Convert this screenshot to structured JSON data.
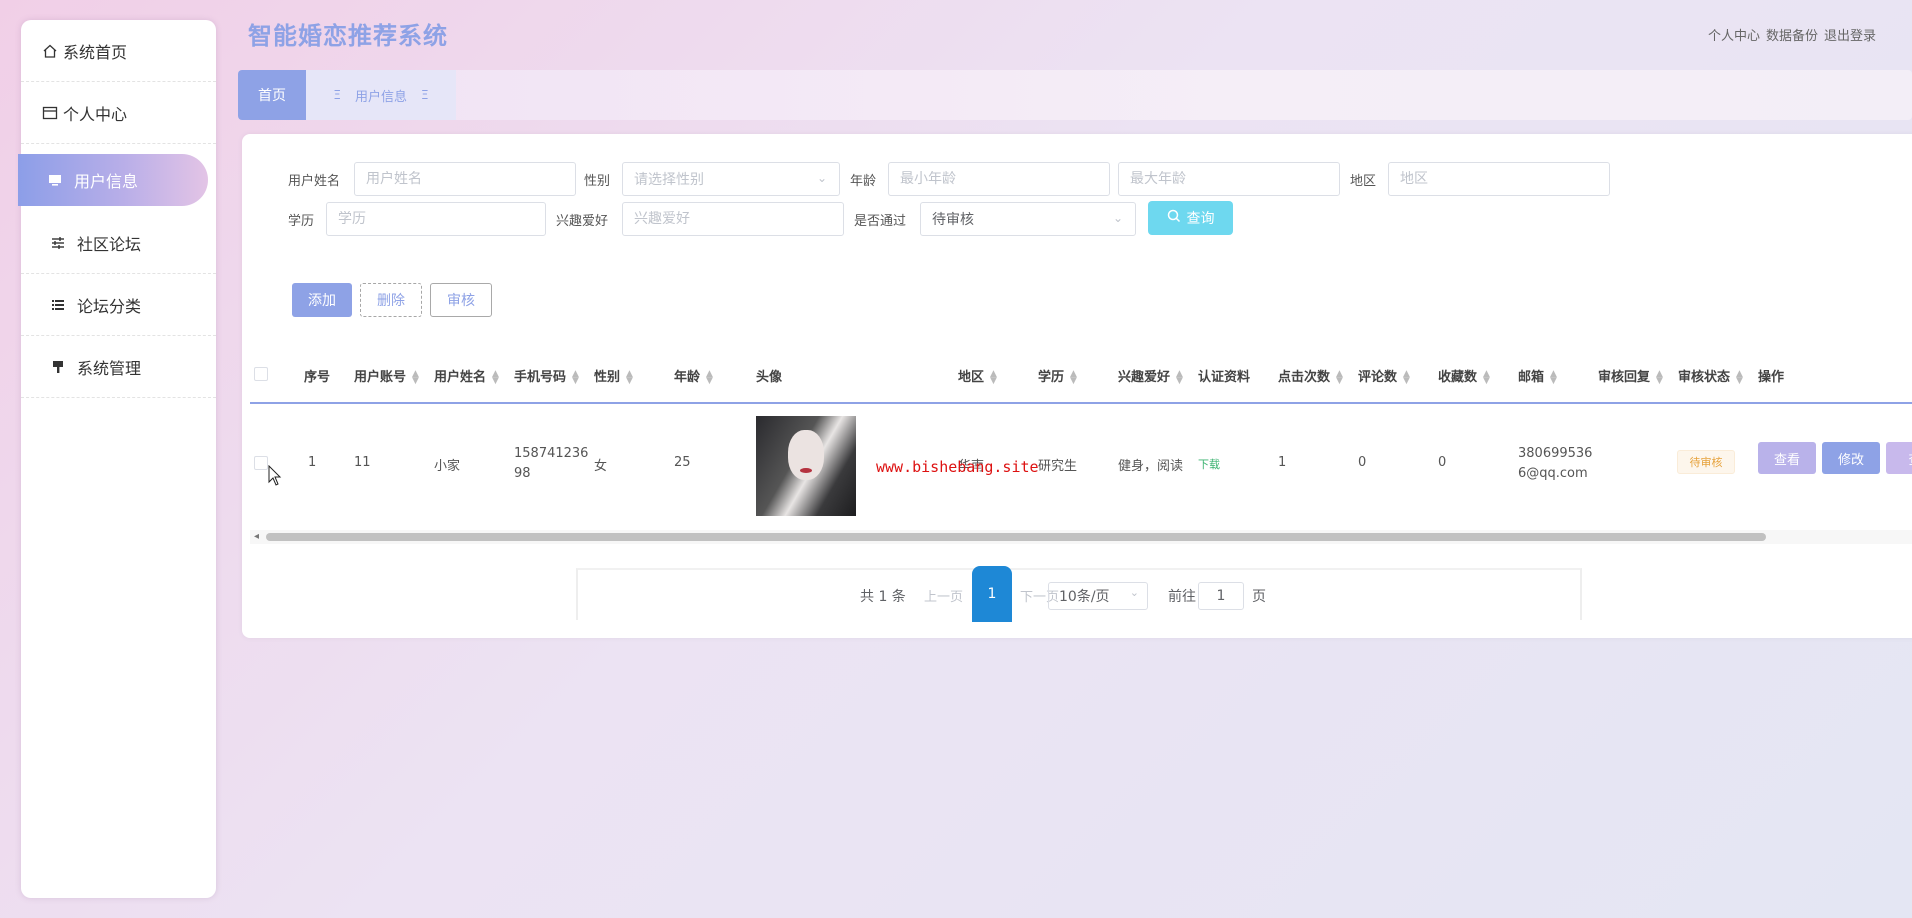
{
  "app": {
    "title": "智能婚恋推荐系统"
  },
  "header": {
    "links": [
      "个人中心",
      "数据备份",
      "退出登录"
    ]
  },
  "sidebar": {
    "items": [
      {
        "label": "系统首页",
        "icon": "home-icon"
      },
      {
        "label": "个人中心",
        "icon": "window-icon"
      },
      {
        "label": "用户信息",
        "icon": "monitor-icon",
        "active": true
      },
      {
        "label": "社区论坛",
        "icon": "sliders-icon"
      },
      {
        "label": "论坛分类",
        "icon": "list-icon"
      },
      {
        "label": "系统管理",
        "icon": "brush-icon"
      }
    ]
  },
  "tabs": {
    "home": "首页",
    "current": "用户信息"
  },
  "search": {
    "name_label": "用户姓名",
    "name_placeholder": "用户姓名",
    "gender_label": "性别",
    "gender_placeholder": "请选择性别",
    "age_label": "年龄",
    "age_min_placeholder": "最小年龄",
    "age_max_placeholder": "最大年龄",
    "region_label": "地区",
    "region_placeholder": "地区",
    "edu_label": "学历",
    "edu_placeholder": "学历",
    "hobby_label": "兴趣爱好",
    "hobby_placeholder": "兴趣爱好",
    "pass_label": "是否通过",
    "pass_value": "待审核",
    "query_button": "查询"
  },
  "actions": {
    "add": "添加",
    "delete": "删除",
    "audit": "审核"
  },
  "table": {
    "columns": [
      "序号",
      "用户账号",
      "用户姓名",
      "手机号码",
      "性别",
      "年龄",
      "头像",
      "地区",
      "学历",
      "兴趣爱好",
      "认证资料",
      "点击次数",
      "评论数",
      "收藏数",
      "邮箱",
      "审核回复",
      "审核状态",
      "操作"
    ],
    "rows": [
      {
        "index": "1",
        "account": "11",
        "name": "小家",
        "phone_l1": "158741236",
        "phone_l2": "98",
        "gender": "女",
        "age": "25",
        "region": "华南",
        "edu": "研究生",
        "hobby": "健身，阅读",
        "cert": "下载",
        "clicks": "1",
        "comments": "0",
        "favorites": "0",
        "email_l1": "380699536",
        "email_l2": "6@qq.com",
        "reply": "",
        "status": "待审核",
        "op_view": "查看",
        "op_edit": "修改",
        "op_more": "查"
      }
    ]
  },
  "pagination": {
    "total": "共 1 条",
    "prev": "上一页",
    "page": "1",
    "next": "下一页",
    "size": "10条/页",
    "goto": "前往",
    "goto_value": "1",
    "page_unit": "页"
  },
  "watermark": "www.bishebang.site",
  "colors": {
    "accent": "#8ea2e6",
    "query": "#6ed8ef",
    "pager_active": "#1e88d6",
    "pending": "#e6a23c",
    "op_view": "#b9b2ea",
    "op_edit": "#8ea2e6"
  }
}
